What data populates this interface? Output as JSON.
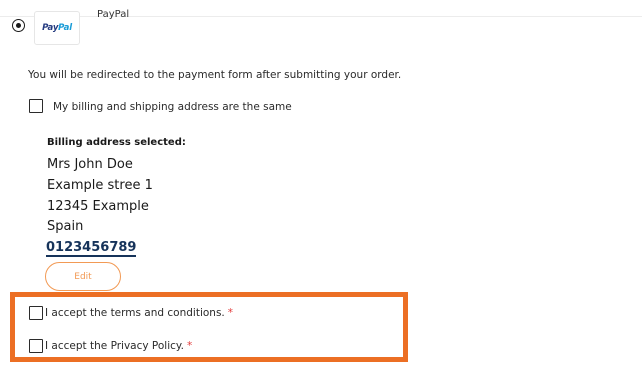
{
  "payment_method": {
    "name": "PayPal",
    "logo_text_pay": "Pay",
    "logo_text_pal": "Pal",
    "selected": true,
    "note": "You will be redirected to the payment form after submitting your order."
  },
  "billing": {
    "same_as_shipping_label": "My billing and shipping address are the same",
    "same_as_shipping_checked": false,
    "selected_heading": "Billing address selected:",
    "name": "Mrs John Doe",
    "street": "Example stree 1",
    "city": "12345 Example",
    "country": "Spain",
    "phone": "0123456789",
    "edit_label": "Edit"
  },
  "agreements": {
    "terms_label": "I accept the terms and conditions.",
    "terms_checked": false,
    "privacy_label": "I accept the Privacy Policy.",
    "privacy_checked": false,
    "required_marker": "*"
  },
  "colors": {
    "highlight": "#ec6f24",
    "edit_accent": "#f29a55",
    "phone_link": "#16335a",
    "required": "#e23b3b",
    "paypal_dark": "#253b80",
    "paypal_light": "#179bd7"
  },
  "icons": {
    "radio": "radio-selected-icon",
    "checkbox": "checkbox-unchecked-icon",
    "logo": "paypal-logo"
  }
}
